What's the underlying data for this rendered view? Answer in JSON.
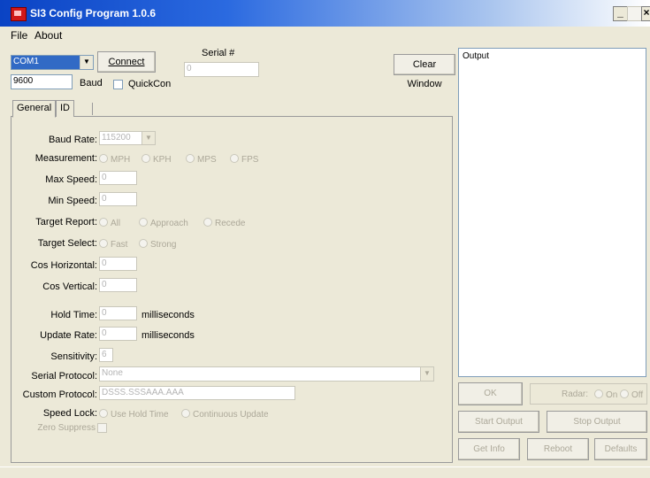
{
  "window": {
    "title": "SI3 Config Program 1.0.6",
    "min_glyph": "_",
    "close_glyph": "×"
  },
  "menu": {
    "file": "File",
    "about": "About"
  },
  "conn": {
    "port": "COM1",
    "connect": "Connect",
    "serial_label": "Serial #",
    "serial_value": "0",
    "baud_value": "9600",
    "baud_label": "Baud",
    "quickcon": "QuickCon",
    "clear_window": "Clear Window"
  },
  "tabs": {
    "general": "General",
    "id": "ID"
  },
  "form": {
    "baud_rate_label": "Baud Rate:",
    "baud_rate_value": "115200",
    "measurement_label": "Measurement:",
    "measurement_options": [
      "MPH",
      "KPH",
      "MPS",
      "FPS"
    ],
    "max_speed_label": "Max Speed:",
    "max_speed_value": "0",
    "min_speed_label": "Min Speed:",
    "min_speed_value": "0",
    "target_report_label": "Target Report:",
    "target_report_options": [
      "All",
      "Approach",
      "Recede"
    ],
    "target_select_label": "Target Select:",
    "target_select_options": [
      "Fast",
      "Strong"
    ],
    "cos_h_label": "Cos Horizontal:",
    "cos_h_value": "0",
    "cos_v_label": "Cos Vertical:",
    "cos_v_value": "0",
    "hold_time_label": "Hold Time:",
    "hold_time_value": "0",
    "hold_time_unit": "milliseconds",
    "update_rate_label": "Update Rate:",
    "update_rate_value": "0",
    "update_rate_unit": "milliseconds",
    "sensitivity_label": "Sensitivity:",
    "sensitivity_value": "6",
    "serial_protocol_label": "Serial Protocol:",
    "serial_protocol_value": "None",
    "custom_protocol_label": "Custom Protocol:",
    "custom_protocol_value": "DSSS.SSSAAA.AAA",
    "speed_lock_label": "Speed Lock:",
    "speed_lock_options": [
      "Use Hold Time",
      "Continuous Update"
    ],
    "zero_suppress_label": "Zero Suppress"
  },
  "output": {
    "label": "Output"
  },
  "actions": {
    "ok": "OK",
    "radar_label": "Radar:",
    "radar_on": "On",
    "radar_off": "Off",
    "start_output": "Start Output",
    "stop_output": "Stop Output",
    "get_info": "Get Info",
    "reboot": "Reboot",
    "defaults": "Defaults"
  }
}
